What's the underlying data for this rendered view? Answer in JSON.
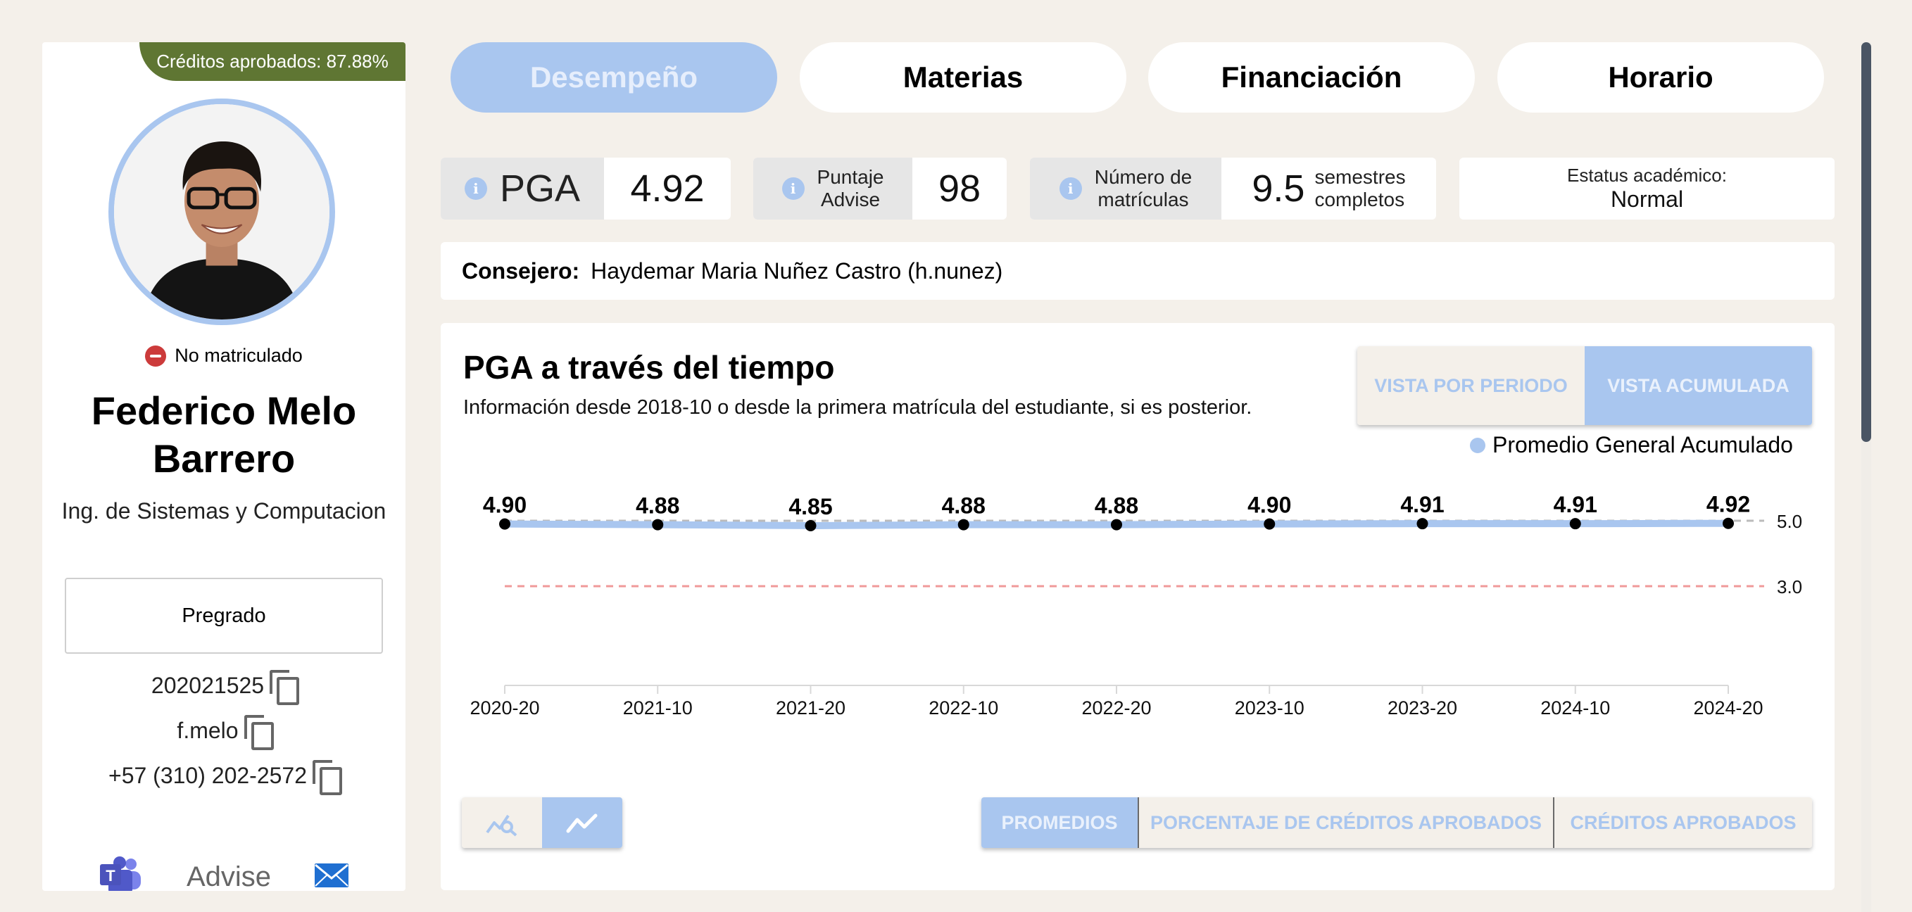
{
  "profile": {
    "credits_badge": "Créditos aprobados: 87.88%",
    "status": "No matriculado",
    "name": "Federico Melo Barrero",
    "program": "Ing. de Sistemas y Computacion",
    "level": "Pregrado",
    "student_id": "202021525",
    "username": "f.melo",
    "phone": "+57 (310) 202-2572",
    "advise_label": "Advise",
    "colors": {
      "badge": "#5f7633",
      "avatar_ring": "#a9c6ef",
      "status": "#cc3b3b"
    }
  },
  "tabs": [
    {
      "label": "Desempeño",
      "active": true
    },
    {
      "label": "Materias",
      "active": false
    },
    {
      "label": "Financiación",
      "active": false
    },
    {
      "label": "Horario",
      "active": false
    }
  ],
  "stats": {
    "pga": {
      "label": "PGA",
      "value": "4.92"
    },
    "advise": {
      "label_line1": "Puntaje",
      "label_line2": "Advise",
      "value": "98"
    },
    "enrollments": {
      "label_line1": "Número de",
      "label_line2": "matrículas",
      "value": "9.5",
      "suffix_line1": "semestres",
      "suffix_line2": "completos"
    },
    "academic_status": {
      "label": "Estatus académico:",
      "value": "Normal"
    }
  },
  "advisor": {
    "label": "Consejero:",
    "name": "Haydemar Maria Nuñez Castro (h.nunez)"
  },
  "chart_panel": {
    "title": "PGA a través del tiempo",
    "subtitle": "Información desde 2018-10 o desde la primera matrícula del estudiante, si es posterior.",
    "view_buttons": [
      {
        "label": "VISTA POR PERIODO",
        "active": false
      },
      {
        "label": "VISTA ACUMULADA",
        "active": true
      }
    ],
    "metric_buttons": [
      {
        "label": "PROMEDIOS",
        "active": true
      },
      {
        "label": "PORCENTAJE DE CRÉDITOS APROBADOS",
        "active": false
      },
      {
        "label": "CRÉDITOS APROBADOS",
        "active": false
      }
    ],
    "chart_modes": [
      {
        "icon": "chart-search-icon",
        "active": false
      },
      {
        "icon": "line-chart-icon",
        "active": true
      }
    ]
  },
  "chart_data": {
    "type": "line",
    "title": "PGA a través del tiempo",
    "categories": [
      "2020-20",
      "2021-10",
      "2021-20",
      "2022-10",
      "2022-20",
      "2023-10",
      "2023-20",
      "2024-10",
      "2024-20"
    ],
    "series": [
      {
        "name": "Promedio General Acumulado",
        "values": [
          4.9,
          4.88,
          4.85,
          4.88,
          4.88,
          4.9,
          4.91,
          4.91,
          4.92
        ],
        "color": "#a9c6ef"
      }
    ],
    "reference_lines": [
      {
        "value": 5.0,
        "label": "5.0",
        "color": "#bbbbbb"
      },
      {
        "value": 3.0,
        "label": "3.0",
        "color": "#f09a9a"
      }
    ],
    "data_labels": [
      "4.90",
      "4.88",
      "4.85",
      "4.88",
      "4.88",
      "4.90",
      "4.91",
      "4.91",
      "4.92"
    ],
    "legend": "top-right",
    "grid": false
  }
}
